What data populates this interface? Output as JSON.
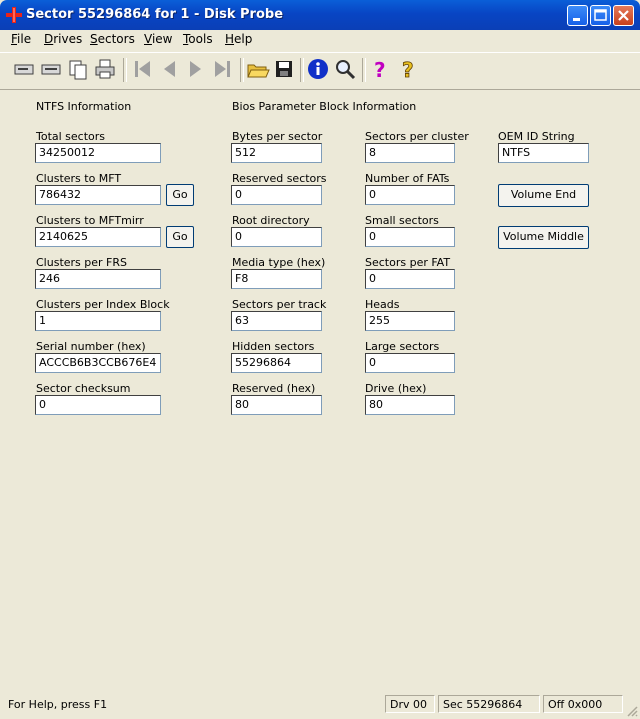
{
  "window": {
    "title": "Sector 55296864 for 1 - Disk Probe"
  },
  "menu": [
    {
      "key": "F",
      "rest": "ile"
    },
    {
      "key": "D",
      "rest": "rives"
    },
    {
      "key": "S",
      "rest": "ectors"
    },
    {
      "key": "V",
      "rest": "iew"
    },
    {
      "key": "T",
      "rest": "ools"
    },
    {
      "key": "H",
      "rest": "elp"
    }
  ],
  "toolbar": {
    "icons": [
      "drive-icon",
      "drive-alt-icon",
      "copy-icon",
      "print-icon",
      "first-icon",
      "prev-icon",
      "next-icon",
      "last-icon",
      "open-folder-icon",
      "save-icon",
      "info-icon",
      "search-icon",
      "help-icon",
      "context-help-icon"
    ]
  },
  "ntfs": {
    "heading": "NTFS Information",
    "total_sectors": {
      "label": "Total sectors",
      "value": "34250012"
    },
    "clusters_to_mft": {
      "label": "Clusters to MFT",
      "value": "786432"
    },
    "clusters_to_mftmirr": {
      "label": "Clusters to MFTmirr",
      "value": "2140625"
    },
    "clusters_per_frs": {
      "label": "Clusters per FRS",
      "value": "246"
    },
    "clusters_per_index": {
      "label": "Clusters per Index Block",
      "value": "1"
    },
    "serial_number": {
      "label": "Serial number (hex)",
      "value": "ACCCB6B3CCB676E4"
    },
    "sector_checksum": {
      "label": "Sector checksum",
      "value": "0"
    },
    "go_label": "Go"
  },
  "bpb": {
    "heading": "Bios Parameter Block Information",
    "bytes_per_sector": {
      "label": "Bytes per sector",
      "value": "512"
    },
    "reserved_sectors": {
      "label": "Reserved sectors",
      "value": "0"
    },
    "root_directory": {
      "label": "Root directory",
      "value": "0"
    },
    "media_type": {
      "label": "Media type (hex)",
      "value": "F8"
    },
    "sectors_per_track": {
      "label": "Sectors per track",
      "value": "63"
    },
    "hidden_sectors": {
      "label": "Hidden sectors",
      "value": "55296864"
    },
    "reserved_hex": {
      "label": "Reserved (hex)",
      "value": "80"
    },
    "sectors_per_cluster": {
      "label": "Sectors per cluster",
      "value": "8"
    },
    "number_of_fats": {
      "label": "Number of FATs",
      "value": "0"
    },
    "small_sectors": {
      "label": "Small sectors",
      "value": "0"
    },
    "sectors_per_fat": {
      "label": "Sectors per FAT",
      "value": "0"
    },
    "heads": {
      "label": "Heads",
      "value": "255"
    },
    "large_sectors": {
      "label": "Large sectors",
      "value": "0"
    },
    "drive_hex": {
      "label": "Drive (hex)",
      "value": "80"
    }
  },
  "oem": {
    "label": "OEM ID String",
    "value": "NTFS",
    "volume_end": "Volume End",
    "volume_middle": "Volume Middle"
  },
  "status": {
    "help": "For Help, press F1",
    "drive": "Drv  00",
    "sector": "Sec 55296864",
    "offset": "Off 0x000"
  }
}
